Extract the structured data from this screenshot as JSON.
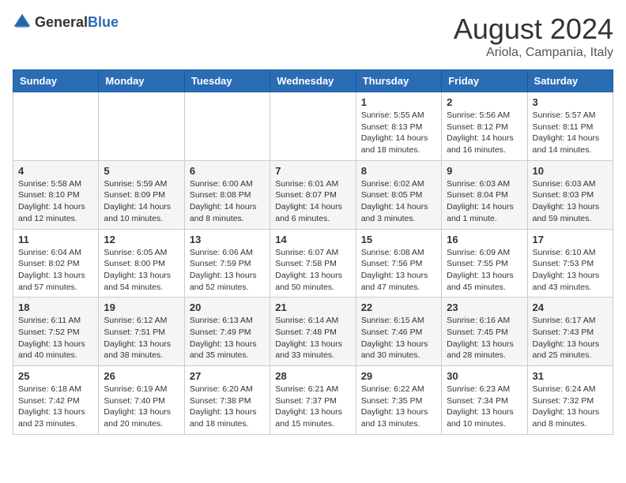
{
  "header": {
    "logo_general": "General",
    "logo_blue": "Blue",
    "month_year": "August 2024",
    "location": "Ariola, Campania, Italy"
  },
  "weekdays": [
    "Sunday",
    "Monday",
    "Tuesday",
    "Wednesday",
    "Thursday",
    "Friday",
    "Saturday"
  ],
  "weeks": [
    [
      {
        "day": "",
        "info": ""
      },
      {
        "day": "",
        "info": ""
      },
      {
        "day": "",
        "info": ""
      },
      {
        "day": "",
        "info": ""
      },
      {
        "day": "1",
        "info": "Sunrise: 5:55 AM\nSunset: 8:13 PM\nDaylight: 14 hours\nand 18 minutes."
      },
      {
        "day": "2",
        "info": "Sunrise: 5:56 AM\nSunset: 8:12 PM\nDaylight: 14 hours\nand 16 minutes."
      },
      {
        "day": "3",
        "info": "Sunrise: 5:57 AM\nSunset: 8:11 PM\nDaylight: 14 hours\nand 14 minutes."
      }
    ],
    [
      {
        "day": "4",
        "info": "Sunrise: 5:58 AM\nSunset: 8:10 PM\nDaylight: 14 hours\nand 12 minutes."
      },
      {
        "day": "5",
        "info": "Sunrise: 5:59 AM\nSunset: 8:09 PM\nDaylight: 14 hours\nand 10 minutes."
      },
      {
        "day": "6",
        "info": "Sunrise: 6:00 AM\nSunset: 8:08 PM\nDaylight: 14 hours\nand 8 minutes."
      },
      {
        "day": "7",
        "info": "Sunrise: 6:01 AM\nSunset: 8:07 PM\nDaylight: 14 hours\nand 6 minutes."
      },
      {
        "day": "8",
        "info": "Sunrise: 6:02 AM\nSunset: 8:05 PM\nDaylight: 14 hours\nand 3 minutes."
      },
      {
        "day": "9",
        "info": "Sunrise: 6:03 AM\nSunset: 8:04 PM\nDaylight: 14 hours\nand 1 minute."
      },
      {
        "day": "10",
        "info": "Sunrise: 6:03 AM\nSunset: 8:03 PM\nDaylight: 13 hours\nand 59 minutes."
      }
    ],
    [
      {
        "day": "11",
        "info": "Sunrise: 6:04 AM\nSunset: 8:02 PM\nDaylight: 13 hours\nand 57 minutes."
      },
      {
        "day": "12",
        "info": "Sunrise: 6:05 AM\nSunset: 8:00 PM\nDaylight: 13 hours\nand 54 minutes."
      },
      {
        "day": "13",
        "info": "Sunrise: 6:06 AM\nSunset: 7:59 PM\nDaylight: 13 hours\nand 52 minutes."
      },
      {
        "day": "14",
        "info": "Sunrise: 6:07 AM\nSunset: 7:58 PM\nDaylight: 13 hours\nand 50 minutes."
      },
      {
        "day": "15",
        "info": "Sunrise: 6:08 AM\nSunset: 7:56 PM\nDaylight: 13 hours\nand 47 minutes."
      },
      {
        "day": "16",
        "info": "Sunrise: 6:09 AM\nSunset: 7:55 PM\nDaylight: 13 hours\nand 45 minutes."
      },
      {
        "day": "17",
        "info": "Sunrise: 6:10 AM\nSunset: 7:53 PM\nDaylight: 13 hours\nand 43 minutes."
      }
    ],
    [
      {
        "day": "18",
        "info": "Sunrise: 6:11 AM\nSunset: 7:52 PM\nDaylight: 13 hours\nand 40 minutes."
      },
      {
        "day": "19",
        "info": "Sunrise: 6:12 AM\nSunset: 7:51 PM\nDaylight: 13 hours\nand 38 minutes."
      },
      {
        "day": "20",
        "info": "Sunrise: 6:13 AM\nSunset: 7:49 PM\nDaylight: 13 hours\nand 35 minutes."
      },
      {
        "day": "21",
        "info": "Sunrise: 6:14 AM\nSunset: 7:48 PM\nDaylight: 13 hours\nand 33 minutes."
      },
      {
        "day": "22",
        "info": "Sunrise: 6:15 AM\nSunset: 7:46 PM\nDaylight: 13 hours\nand 30 minutes."
      },
      {
        "day": "23",
        "info": "Sunrise: 6:16 AM\nSunset: 7:45 PM\nDaylight: 13 hours\nand 28 minutes."
      },
      {
        "day": "24",
        "info": "Sunrise: 6:17 AM\nSunset: 7:43 PM\nDaylight: 13 hours\nand 25 minutes."
      }
    ],
    [
      {
        "day": "25",
        "info": "Sunrise: 6:18 AM\nSunset: 7:42 PM\nDaylight: 13 hours\nand 23 minutes."
      },
      {
        "day": "26",
        "info": "Sunrise: 6:19 AM\nSunset: 7:40 PM\nDaylight: 13 hours\nand 20 minutes."
      },
      {
        "day": "27",
        "info": "Sunrise: 6:20 AM\nSunset: 7:38 PM\nDaylight: 13 hours\nand 18 minutes."
      },
      {
        "day": "28",
        "info": "Sunrise: 6:21 AM\nSunset: 7:37 PM\nDaylight: 13 hours\nand 15 minutes."
      },
      {
        "day": "29",
        "info": "Sunrise: 6:22 AM\nSunset: 7:35 PM\nDaylight: 13 hours\nand 13 minutes."
      },
      {
        "day": "30",
        "info": "Sunrise: 6:23 AM\nSunset: 7:34 PM\nDaylight: 13 hours\nand 10 minutes."
      },
      {
        "day": "31",
        "info": "Sunrise: 6:24 AM\nSunset: 7:32 PM\nDaylight: 13 hours\nand 8 minutes."
      }
    ]
  ]
}
